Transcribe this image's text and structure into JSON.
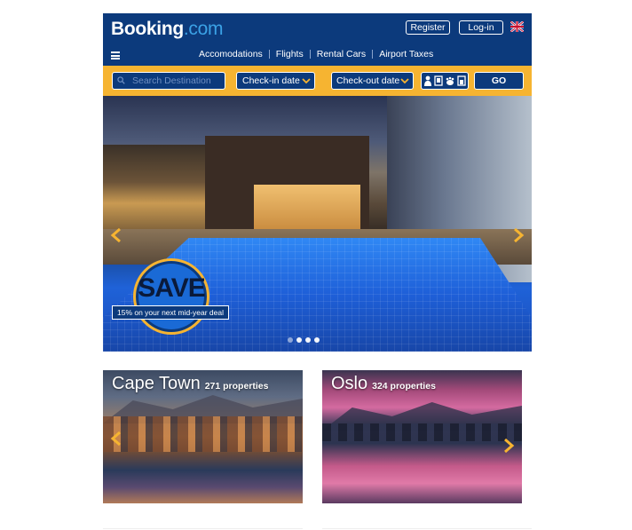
{
  "header": {
    "logo_main": "Booking",
    "logo_tld": ".com",
    "register_label": "Register",
    "login_label": "Log-in",
    "flag_icon": "uk-flag-icon",
    "menu_icon": "hamburger-menu-icon",
    "nav": [
      "Accomodations",
      "Flights",
      "Rental Cars",
      "Airport Taxes"
    ]
  },
  "search": {
    "placeholder": "Search Destination",
    "checkin_label": "Check-in date",
    "checkout_label": "Check-out date",
    "guests_icons": [
      "person-icon",
      "room-icon",
      "pet-icon",
      "child-icon"
    ],
    "go_label": "GO"
  },
  "hero": {
    "save_title": "SAVE",
    "save_subtitle": "15% on your next mid-year deal",
    "slide_count": 4,
    "active_slide": 2
  },
  "cards": [
    {
      "city": "Cape Town",
      "properties": "271 properties"
    },
    {
      "city": "Oslo",
      "properties": "324 properties"
    }
  ],
  "colors": {
    "brand_blue": "#0c3a7c",
    "accent_yellow": "#f6b431",
    "logo_tld": "#3ba2e6"
  }
}
